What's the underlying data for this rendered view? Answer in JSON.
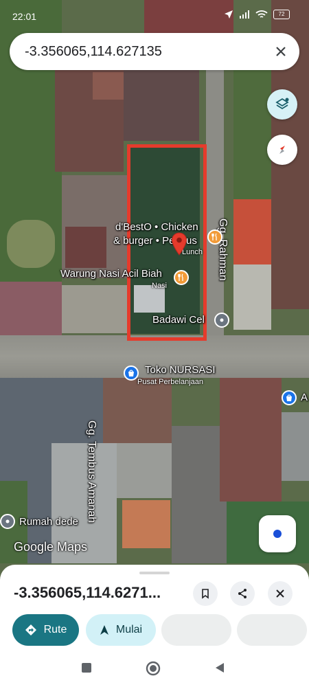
{
  "status": {
    "time": "22:01",
    "battery": "72"
  },
  "search": {
    "query": "-3.356065,114.627135"
  },
  "map": {
    "labels": [
      {
        "text": "d'BestO • Chicken",
        "id": "poi-dbesto-line1"
      },
      {
        "text": "& burger • Per",
        "id": "poi-dbesto-line2"
      },
      {
        "text": "Warung Nasi Acil Biah",
        "id": "poi-warung"
      },
      {
        "text": "Badawi Cel",
        "id": "poi-badawi"
      },
      {
        "text": "Toko NURSASI",
        "id": "poi-toko"
      },
      {
        "text": "Rumah dede",
        "id": "poi-rumah"
      }
    ],
    "fragments": {
      "dbesto_tail": "us",
      "dbesto_sub": "Lunch",
      "warung_sub": "Nasi",
      "toko_sub": "Pusat Perbelanjaan",
      "edge_label": "A"
    },
    "streets": {
      "rahman": "Gg. Rahman",
      "amanah": "Gg. Tembus Amanah"
    },
    "attribution": "Google Maps"
  },
  "sheet": {
    "title": "-3.356065,114.6271...",
    "route_label": "Rute",
    "start_label": "Mulai"
  },
  "colors": {
    "accent": "#1a7683",
    "chip_light": "#d2f1f7",
    "highlight": "#e53b2c",
    "poi_food": "#f29b38",
    "poi_shop": "#1a73e8",
    "poi_grey": "#6b7580"
  },
  "icons": [
    "navigation-arrow-icon",
    "wifi-icon",
    "signal-icon",
    "battery-icon",
    "close-icon",
    "layers-icon",
    "compass-icon",
    "my-location-icon",
    "bookmark-icon",
    "share-icon",
    "directions-icon",
    "start-arrow-icon",
    "recent-apps-icon",
    "home-icon",
    "back-icon",
    "map-pin-icon",
    "restaurant-icon",
    "shopping-icon"
  ]
}
